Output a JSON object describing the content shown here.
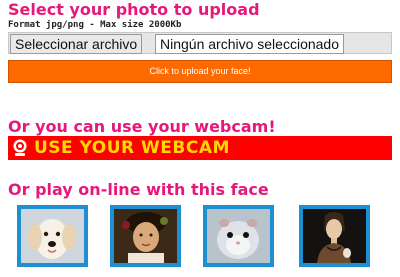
{
  "upload": {
    "heading": "Select your photo to upload",
    "format_note": "Format jpg/png - Max size 2000Kb",
    "file_button_label": "Seleccionar archivo",
    "file_status": "Ningún archivo seleccionado",
    "upload_button_label": "Click to upload your face!"
  },
  "webcam": {
    "heading": "Or you can use your webcam!",
    "button_label": "USE YOUR WEBCAM",
    "icon": "webcam-icon"
  },
  "sample_faces": {
    "heading": "Or play on-line with this face",
    "items": [
      {
        "icon": "puppy-face-image"
      },
      {
        "icon": "painted-boy-face-image"
      },
      {
        "icon": "hamster-face-image"
      },
      {
        "icon": "lady-portrait-image"
      }
    ]
  },
  "colors": {
    "heading": "#e8177a",
    "upload_button": "#ff6a00",
    "webcam_button": "#ff0000",
    "webcam_text": "#ffd800",
    "thumb_border": "#1e8fd0"
  }
}
